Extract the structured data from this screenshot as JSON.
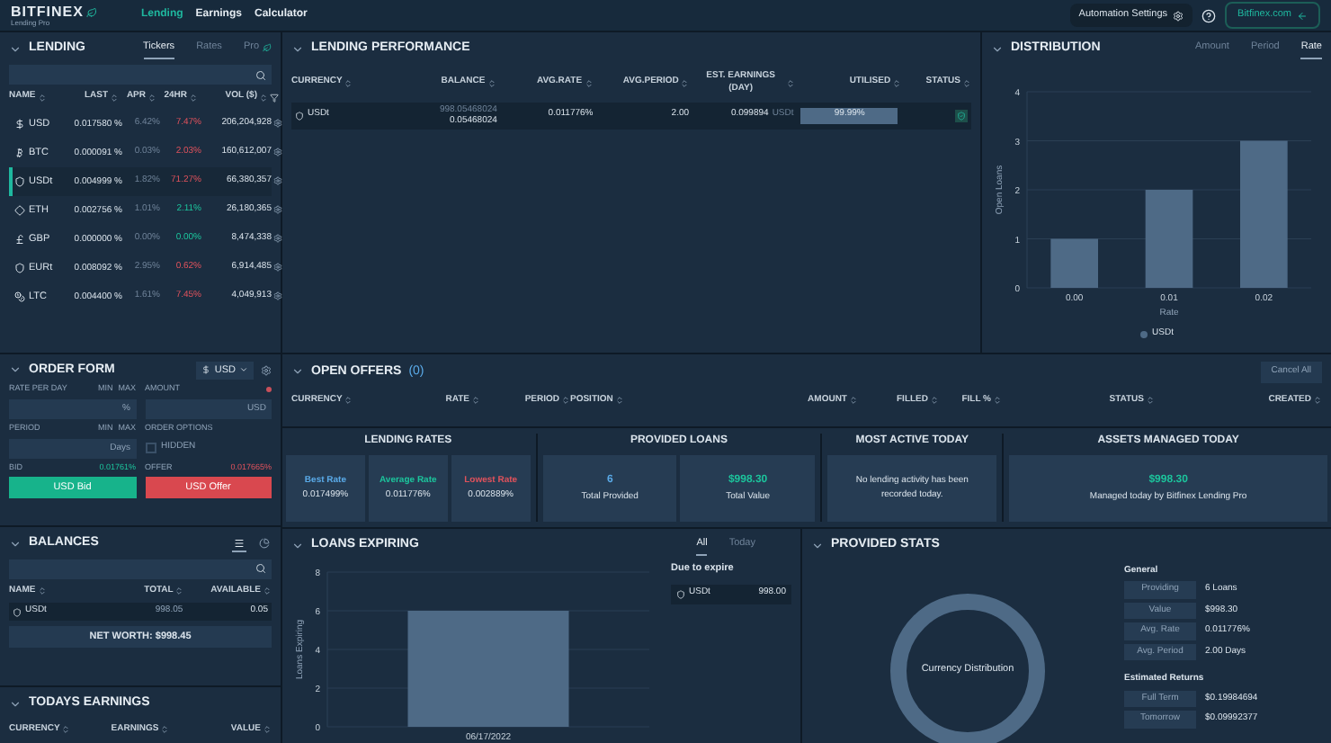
{
  "header": {
    "logo": "BITFINEX",
    "logo_subtitle": "Lending Pro",
    "nav": [
      {
        "label": "Lending",
        "selected": true
      },
      {
        "label": "Earnings",
        "selected": false
      },
      {
        "label": "Calculator",
        "selected": false
      }
    ],
    "automation_button": "Automation Settings",
    "site_button": "Bitfinex.com"
  },
  "lending": {
    "title": "LENDING",
    "tabs": [
      {
        "label": "Tickers",
        "selected": true
      },
      {
        "label": "Rates",
        "selected": false
      },
      {
        "label": "Pro",
        "selected": false
      }
    ],
    "columns": [
      "NAME",
      "LAST",
      "APR",
      "24HR",
      "VOL ($)"
    ],
    "rows": [
      {
        "kind": "dollar",
        "name": "USD",
        "last": "0.017580 %",
        "apr": "6.42%",
        "change": "7.47%",
        "positive": false,
        "volume": "206,204,928",
        "selected": false
      },
      {
        "kind": "bitcoin",
        "name": "BTC",
        "last": "0.000091 %",
        "apr": "0.03%",
        "change": "2.03%",
        "positive": false,
        "volume": "160,612,007",
        "selected": false
      },
      {
        "kind": "tether",
        "name": "USDt",
        "last": "0.004999 %",
        "apr": "1.82%",
        "change": "71.27%",
        "positive": false,
        "volume": "66,380,357",
        "selected": true
      },
      {
        "kind": "ether",
        "name": "ETH",
        "last": "0.002756 %",
        "apr": "1.01%",
        "change": "2.11%",
        "positive": true,
        "volume": "26,180,365",
        "selected": false
      },
      {
        "kind": "pound",
        "name": "GBP",
        "last": "0.000000 %",
        "apr": "0.00%",
        "change": "0.00%",
        "positive": true,
        "volume": "8,474,338",
        "selected": false
      },
      {
        "kind": "tether",
        "name": "EURt",
        "last": "0.008092 %",
        "apr": "2.95%",
        "change": "0.62%",
        "positive": false,
        "volume": "6,914,485",
        "selected": false
      },
      {
        "kind": "litecoin",
        "name": "LTC",
        "last": "0.004400 %",
        "apr": "1.61%",
        "change": "7.45%",
        "positive": false,
        "volume": "4,049,913",
        "selected": false
      }
    ]
  },
  "order_form": {
    "title": "ORDER FORM",
    "currency": "USD",
    "rate_label": "RATE PER DAY",
    "rate_min": "MIN",
    "rate_max": "MAX",
    "amount_label": "AMOUNT",
    "rate_placeholder": "%",
    "amount_placeholder": "USD",
    "period_label": "PERIOD",
    "period_min": "MIN",
    "period_max": "MAX",
    "options_label": "ORDER OPTIONS",
    "period_placeholder": "Days",
    "hidden": {
      "label": "HIDDEN",
      "checked": false
    },
    "bid_label": "BID",
    "bid": "0.01761%",
    "offer_label": "OFFER",
    "offer": "0.017665%",
    "bid_button": "USD Bid",
    "offer_button": "USD Offer"
  },
  "balances": {
    "title": "BALANCES",
    "views": [
      {
        "kind": "list",
        "selected": true
      },
      {
        "kind": "pie",
        "selected": false
      }
    ],
    "columns": [
      "NAME",
      "TOTAL",
      "AVAILABLE"
    ],
    "rows": [
      {
        "name": "USDt",
        "total": "998.05",
        "available": "0.05"
      }
    ],
    "net_worth": "NET WORTH: $998.45"
  },
  "todays_earnings": {
    "title": "TODAYS EARNINGS",
    "columns": [
      "CURRENCY",
      "EARNINGS",
      "VALUE"
    ]
  },
  "lending_performance": {
    "title": "LENDING PERFORMANCE",
    "columns": [
      "CURRENCY",
      "BALANCE",
      "AVG.RATE",
      "AVG.PERIOD",
      "EST. EARNINGS (DAY)",
      "UTILISED",
      "STATUS"
    ],
    "rows": [
      {
        "currency": "USDt",
        "balance_total": "998.05468024",
        "balance": "0.05468024",
        "avg_rate": "0.011776%",
        "avg_period": "2.00",
        "est_earnings": "0.099894",
        "est_unit": "USDt",
        "level": 0.9999,
        "utilised": "99.99%"
      }
    ]
  },
  "distribution": {
    "title": "DISTRIBUTION",
    "tabs": [
      {
        "label": "Amount",
        "selected": false
      },
      {
        "label": "Period",
        "selected": false
      },
      {
        "label": "Rate",
        "selected": true
      }
    ],
    "chart_data": {
      "type": "bar",
      "xlabel": "Rate",
      "ylabel": "Open Loans",
      "categories": [
        "0.00",
        "0.01",
        "0.02"
      ],
      "grid": true,
      "series": [
        {
          "name": "USDt",
          "color": "#4e6a86",
          "values": [
            1,
            2,
            3
          ]
        }
      ],
      "ylim": [
        0,
        4
      ],
      "yticks": [
        0,
        1,
        2,
        3,
        4
      ]
    }
  },
  "open_offers": {
    "title": "OPEN OFFERS",
    "count": "(0)",
    "cancel_button": "Cancel All",
    "columns": [
      "CURRENCY",
      "RATE",
      "PERIOD",
      "POSITION",
      "AMOUNT",
      "FILLED",
      "FILL %",
      "STATUS",
      "CREATED"
    ]
  },
  "lending_rates": {
    "title": "LENDING RATES",
    "items": [
      {
        "label": "Best Rate",
        "value": "0.017499%",
        "color": "#5aaae8"
      },
      {
        "label": "Average Rate",
        "value": "0.011776%",
        "color": "#1cc49c"
      },
      {
        "label": "Lowest Rate",
        "value": "0.002889%",
        "color": "#e0525c"
      }
    ]
  },
  "provided_loans": {
    "title": "PROVIDED LOANS",
    "items": [
      {
        "value": "6",
        "label": "Total Provided",
        "color": "#5aaae8"
      },
      {
        "value": "$998.30",
        "label": "Total Value",
        "color": "#1cc49c"
      }
    ]
  },
  "most_active": {
    "title": "MOST ACTIVE TODAY",
    "message": "No lending activity has been recorded today."
  },
  "assets_managed": {
    "title": "ASSETS MANAGED TODAY",
    "value": "$998.30",
    "caption": "Managed today by Bitfinex Lending Pro"
  },
  "loans_expiring": {
    "title": "LOANS EXPIRING",
    "tabs": [
      {
        "label": "All",
        "selected": true
      },
      {
        "label": "Today",
        "selected": false
      }
    ],
    "chart_data": {
      "type": "bar",
      "ylabel": "Loans Expiring",
      "categories": [
        "06/17/2022"
      ],
      "grid": true,
      "series": [
        {
          "color": "#4e6a86",
          "values": [
            6
          ]
        }
      ],
      "ylim": [
        0,
        8
      ],
      "yticks": [
        0,
        2,
        4,
        6,
        8
      ]
    },
    "due_title": "Due to expire",
    "due": [
      {
        "currency": "USDt",
        "amount": "998.00"
      }
    ]
  },
  "provided_stats": {
    "title": "PROVIDED STATS",
    "donut_label": "Currency Distribution",
    "general_title": "General",
    "general": [
      {
        "label": "Providing",
        "value": "6 Loans"
      },
      {
        "label": "Value",
        "value": "$998.30"
      },
      {
        "label": "Avg. Rate",
        "value": "0.011776%"
      },
      {
        "label": "Avg. Period",
        "value": "2.00 Days"
      }
    ],
    "returns_title": "Estimated Returns",
    "returns": [
      {
        "label": "Full Term",
        "value": "$0.19984694"
      },
      {
        "label": "Tomorrow",
        "value": "$0.09992377"
      }
    ]
  }
}
